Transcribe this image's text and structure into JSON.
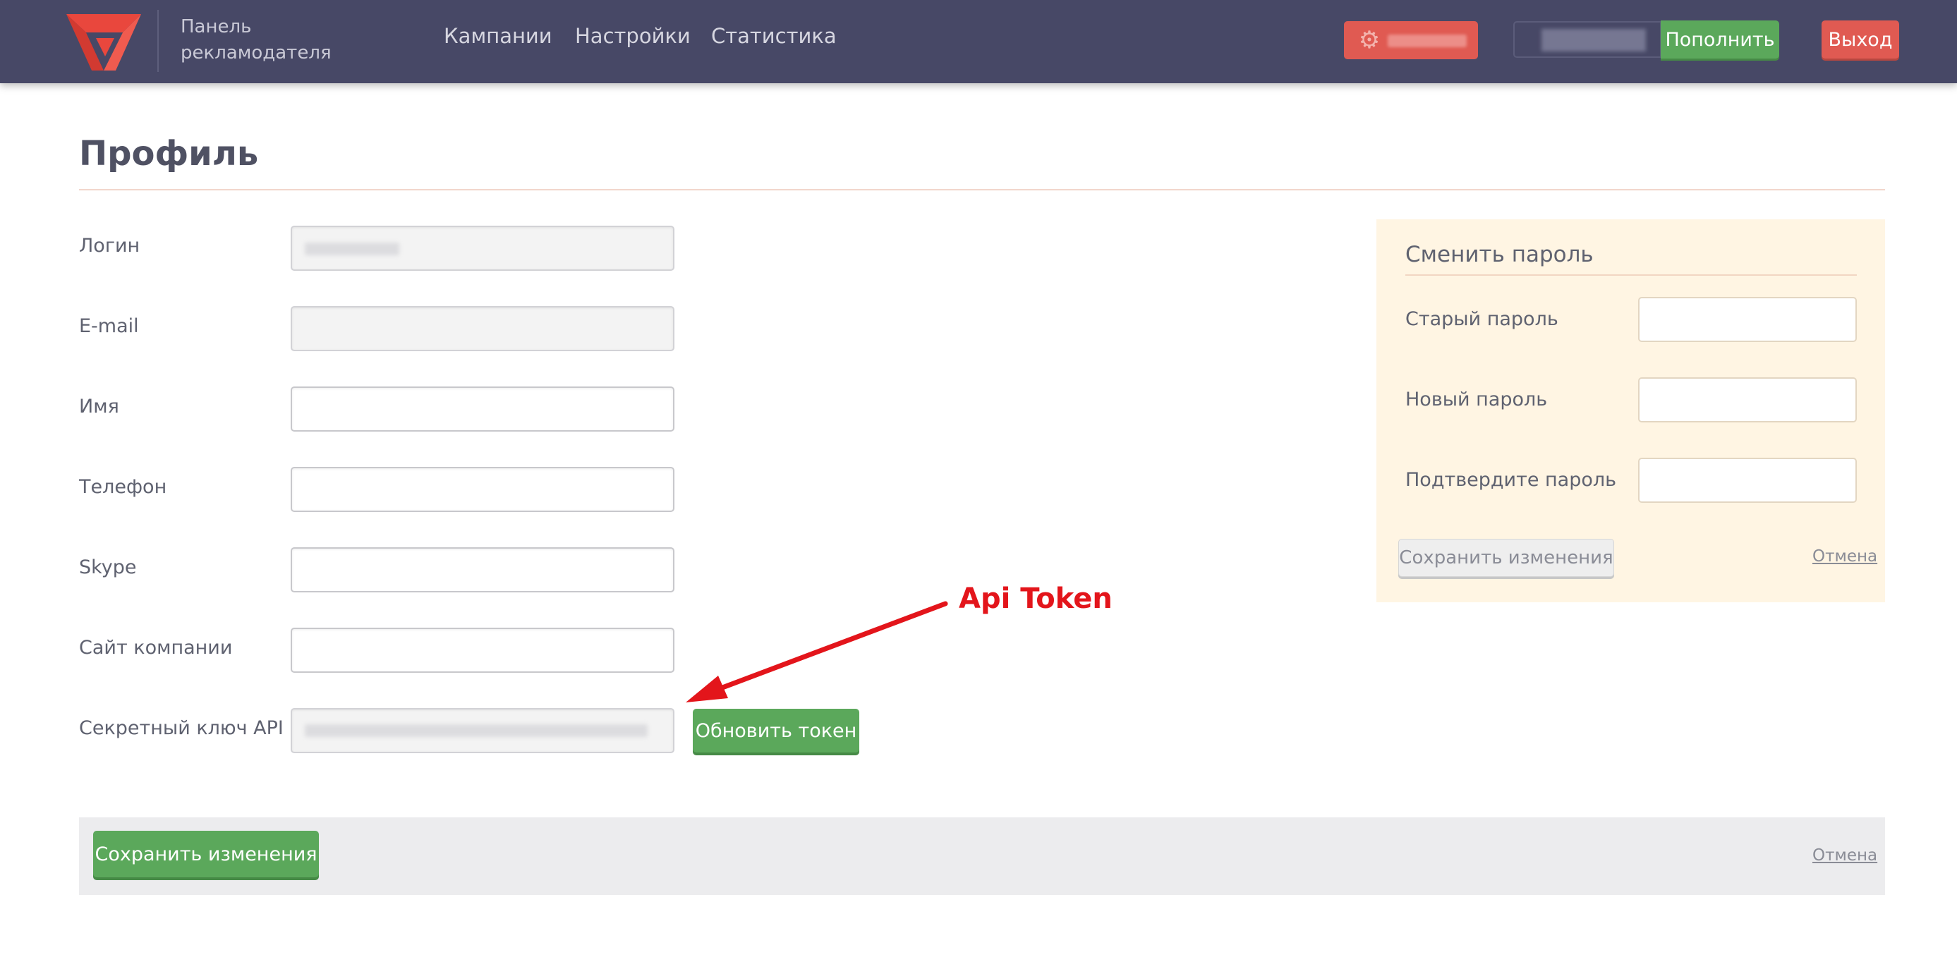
{
  "header": {
    "brand_line1": "Панель",
    "brand_line2": "рекламодателя",
    "nav": [
      "Кампании",
      "Настройки",
      "Статистика"
    ],
    "topup_label": "Пополнить",
    "exit_label": "Выход",
    "gear_icon": "gear-icon"
  },
  "page": {
    "title": "Профиль"
  },
  "profile_form": {
    "fields": [
      {
        "label": "Логин",
        "value": ""
      },
      {
        "label": "E-mail",
        "value": ""
      },
      {
        "label": "Имя",
        "value": ""
      },
      {
        "label": "Телефон",
        "value": ""
      },
      {
        "label": "Skype",
        "value": ""
      },
      {
        "label": "Сайт компании",
        "value": ""
      },
      {
        "label": "Секретный ключ API",
        "value": ""
      }
    ],
    "refresh_token_label": "Обновить токен",
    "save_label": "Сохранить изменения",
    "cancel_label": "Отмена"
  },
  "password_panel": {
    "title": "Сменить пароль",
    "old_label": "Старый пароль",
    "new_label": "Новый пароль",
    "confirm_label": "Подтвердите пароль",
    "save_label": "Сохранить изменения",
    "cancel_label": "Отмена"
  },
  "annotation": {
    "text": "Api Token"
  },
  "colors": {
    "header_bg": "#474866",
    "accent_green": "#5ba85b",
    "accent_red": "#e05a52",
    "panel_bg": "#fff5e3",
    "annotation_red": "#e3151b"
  }
}
